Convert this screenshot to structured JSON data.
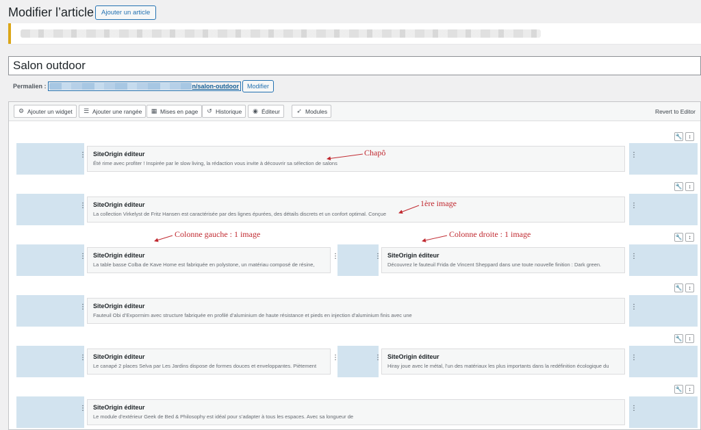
{
  "header": {
    "title": "Modifier l’article",
    "add_button": "Ajouter un article"
  },
  "post": {
    "title": "Salon outdoor"
  },
  "permalink": {
    "label": "Permalien :",
    "slug": "n/salon-outdoor",
    "modify_button": "Modifier"
  },
  "toolbar": {
    "buttons": [
      {
        "label": "Ajouter un widget",
        "icon": "widget-icon"
      },
      {
        "label": "Ajouter une rangée",
        "icon": "row-icon"
      },
      {
        "label": "Mises en page",
        "icon": "layout-icon"
      },
      {
        "label": "Historique",
        "icon": "history-icon"
      },
      {
        "label": "Éditeur",
        "icon": "editor-icon"
      },
      {
        "label": "Modules",
        "icon": "rocket-icon"
      }
    ],
    "revert": "Revert to Editor"
  },
  "rows": [
    {
      "cells": [
        {
          "title": "SiteOrigin éditeur",
          "desc": "Été rime avec profiter ! Inspirée par le slow living, la rédaction vous invite à découvrir sa sélection de salons"
        }
      ]
    },
    {
      "cells": [
        {
          "title": "SiteOrigin éditeur",
          "desc": "La collection Virkelyst de Fritz Hansen est caractérisée par des lignes épurées, des détails discrets et un confort optimal. Conçue"
        }
      ]
    },
    {
      "cells": [
        {
          "title": "SiteOrigin éditeur",
          "desc": "La table basse Colba de Kave Home est fabriquée en polystone, un matériau composé de résine,"
        },
        {
          "title": "SiteOrigin éditeur",
          "desc": "Découvrez le fauteuil Frida de Vincent Sheppard dans une toute nouvelle finition : Dark green."
        }
      ]
    },
    {
      "cells": [
        {
          "title": "SiteOrigin éditeur",
          "desc": "Fauteuil Obi d’Expormim avec structure fabriquée en profilé d’aluminium de haute résistance et pieds en injection d’aluminium finis avec une"
        }
      ]
    },
    {
      "cells": [
        {
          "title": "SiteOrigin éditeur",
          "desc": "Le canapé 2 places Selva par Les Jardins dispose de formes douces et enveloppantes. Piètement"
        },
        {
          "title": "SiteOrigin éditeur",
          "desc": "Hiray joue avec le métal, l’un des matériaux les plus importants dans la redéfinition écologique du"
        }
      ]
    },
    {
      "cells": [
        {
          "title": "SiteOrigin éditeur",
          "desc": "Le module d’extérieur Geek de Bed & Philosophy est idéal pour s’adapter à tous les espaces. Avec sa longueur de"
        }
      ]
    }
  ],
  "annotations": {
    "chapo": "Chapô",
    "first_image": "1ère image",
    "left_col": "Colonne gauche : 1 image",
    "right_col": "Colonne droite : 1 image"
  },
  "colors": {
    "annotation": "#c0282f",
    "row_bg": "#d2e3ef",
    "accent": "#2271b1",
    "notice": "#dba617"
  }
}
